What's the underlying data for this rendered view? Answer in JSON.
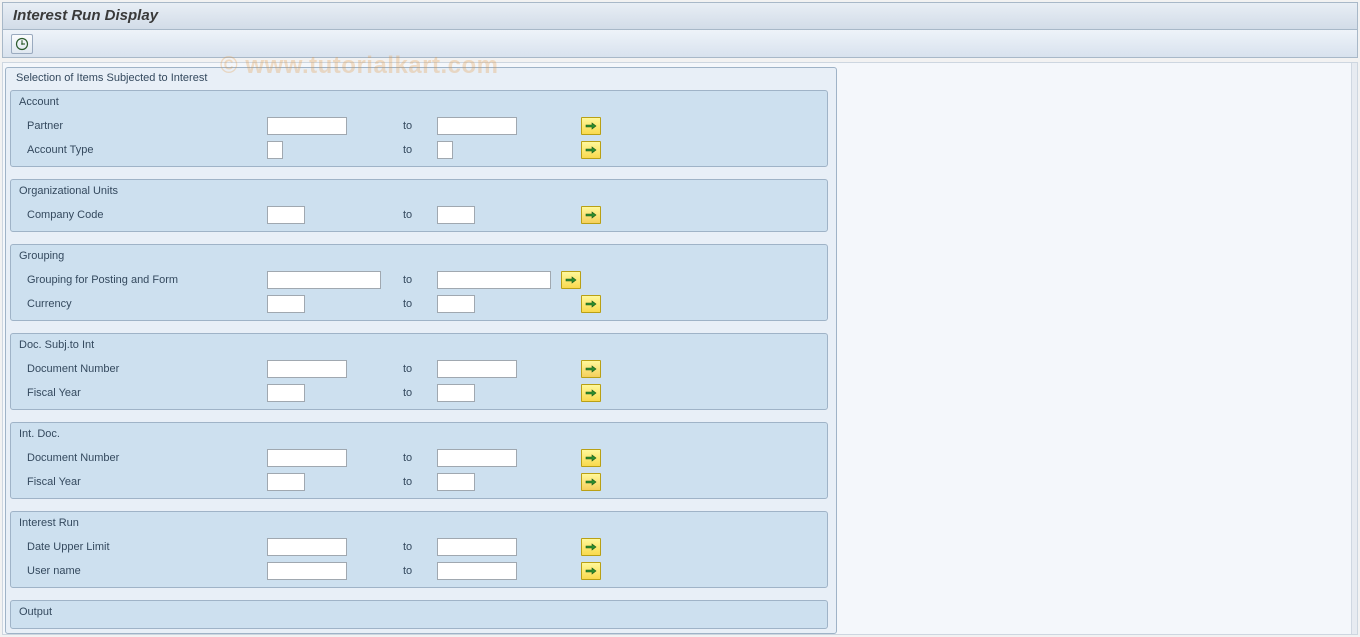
{
  "title": "Interest Run Display",
  "watermark": "© www.tutorialkart.com",
  "toolbar": {
    "execute_label": "Execute"
  },
  "super_group": {
    "title": "Selection of Items Subjected to Interest",
    "groups": [
      {
        "title": "Account",
        "rows": [
          {
            "label": "Partner",
            "from": "",
            "to_label": "to",
            "to": "",
            "width": "long",
            "btn_variant": "normal"
          },
          {
            "label": "Account Type",
            "from": "",
            "to_label": "to",
            "to": "",
            "width": "short",
            "btn_variant": "normal"
          }
        ]
      },
      {
        "title": "Organizational Units",
        "rows": [
          {
            "label": "Company Code",
            "from": "",
            "to_label": "to",
            "to": "",
            "width": "med",
            "btn_variant": "alt"
          }
        ]
      },
      {
        "title": "Grouping",
        "rows": [
          {
            "label": "Grouping for Posting and Form",
            "from": "",
            "to_label": "to",
            "to": "",
            "width": "wide",
            "btn_variant": "normal"
          },
          {
            "label": "Currency",
            "from": "",
            "to_label": "to",
            "to": "",
            "width": "med",
            "btn_variant": "normal"
          }
        ]
      },
      {
        "title": "Doc. Subj.to Int",
        "rows": [
          {
            "label": "Document Number",
            "from": "",
            "to_label": "to",
            "to": "",
            "width": "long",
            "btn_variant": "alt"
          },
          {
            "label": "Fiscal Year",
            "from": "",
            "to_label": "to",
            "to": "",
            "width": "med",
            "btn_variant": "normal"
          }
        ]
      },
      {
        "title": "Int. Doc.",
        "rows": [
          {
            "label": "Document Number",
            "from": "",
            "to_label": "to",
            "to": "",
            "width": "long",
            "btn_variant": "normal"
          },
          {
            "label": "Fiscal Year",
            "from": "",
            "to_label": "to",
            "to": "",
            "width": "med",
            "btn_variant": "alt"
          }
        ]
      },
      {
        "title": "Interest Run",
        "rows": [
          {
            "label": "Date Upper Limit",
            "from": "",
            "to_label": "to",
            "to": "",
            "width": "long",
            "btn_variant": "normal"
          },
          {
            "label": "User name",
            "from": "",
            "to_label": "to",
            "to": "",
            "width": "long",
            "btn_variant": "normal"
          }
        ]
      }
    ],
    "trailing_group": {
      "title": "Output"
    }
  }
}
